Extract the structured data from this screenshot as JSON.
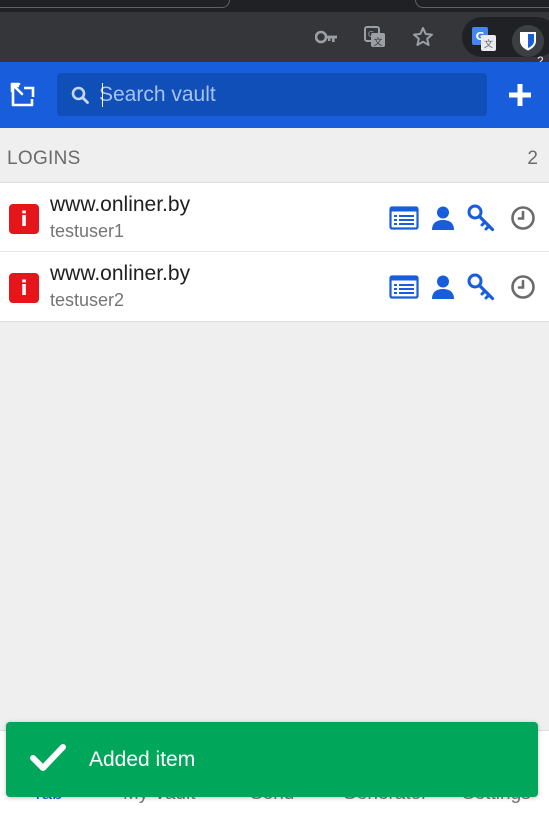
{
  "browser": {
    "extension_badge": "2",
    "icons": [
      "key-icon",
      "translate-icon",
      "star-icon",
      "google-translate-icon",
      "bitwarden-icon"
    ]
  },
  "header": {
    "search_placeholder": "Search vault",
    "popout_icon": "popout-icon",
    "add_icon": "plus-icon"
  },
  "section": {
    "title": "LOGINS",
    "count": "2"
  },
  "items": [
    {
      "name": "www.onliner.by",
      "username": "testuser1",
      "favicon_letter": "i"
    },
    {
      "name": "www.onliner.by",
      "username": "testuser2",
      "favicon_letter": "i"
    }
  ],
  "tabs": [
    {
      "label": "Tab"
    },
    {
      "label": "My Vault"
    },
    {
      "label": "Send"
    },
    {
      "label": "Generator"
    },
    {
      "label": "Settings"
    }
  ],
  "toast": {
    "message": "Added item"
  },
  "colors": {
    "brand": "#175ddc",
    "toast": "#00a65a",
    "favicon": "#e5151a"
  }
}
